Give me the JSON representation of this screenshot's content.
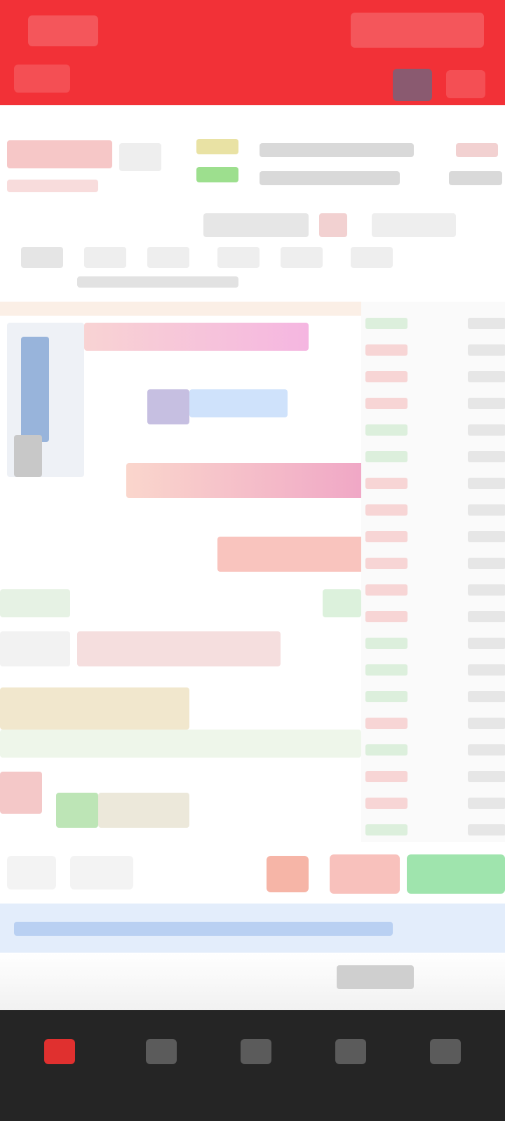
{
  "header": {
    "left_label": "",
    "right_label": "",
    "title": "",
    "subtitle": ""
  },
  "quote": {
    "price": "",
    "change": "",
    "high_label": "",
    "low_label": ""
  },
  "tabs": [],
  "chart": {
    "annotation_1": "",
    "annotation_2": ""
  },
  "order_book": {
    "rows": [
      {
        "price": "",
        "vol": "",
        "dir": "down"
      },
      {
        "price": "",
        "vol": "",
        "dir": "up"
      },
      {
        "price": "",
        "vol": "",
        "dir": "up"
      },
      {
        "price": "",
        "vol": "",
        "dir": "up"
      },
      {
        "price": "",
        "vol": "",
        "dir": "down"
      },
      {
        "price": "",
        "vol": "",
        "dir": "down"
      },
      {
        "price": "",
        "vol": "",
        "dir": "up"
      },
      {
        "price": "",
        "vol": "",
        "dir": "up"
      },
      {
        "price": "",
        "vol": "",
        "dir": "up"
      },
      {
        "price": "",
        "vol": "",
        "dir": "up"
      },
      {
        "price": "",
        "vol": "",
        "dir": "up"
      },
      {
        "price": "",
        "vol": "",
        "dir": "up"
      },
      {
        "price": "",
        "vol": "",
        "dir": "down"
      },
      {
        "price": "",
        "vol": "",
        "dir": "down"
      },
      {
        "price": "",
        "vol": "",
        "dir": "down"
      },
      {
        "price": "",
        "vol": "",
        "dir": "up"
      },
      {
        "price": "",
        "vol": "",
        "dir": "down"
      },
      {
        "price": "",
        "vol": "",
        "dir": "up"
      },
      {
        "price": "",
        "vol": "",
        "dir": "up"
      },
      {
        "price": "",
        "vol": "",
        "dir": "down"
      }
    ]
  },
  "actions": {
    "btn_1": "",
    "btn_2": "",
    "btn_sell": "",
    "btn_buy": ""
  },
  "notice": {
    "text": ""
  },
  "bottom_nav": {
    "items": [
      {
        "label": "",
        "active": true
      },
      {
        "label": "",
        "active": false
      },
      {
        "label": "",
        "active": false
      },
      {
        "label": "",
        "active": false
      },
      {
        "label": "",
        "active": false
      }
    ]
  },
  "colors": {
    "brand_red": "#f23137",
    "up_red": "#e23b3b",
    "down_green": "#27a744",
    "nav_bg": "#252525"
  }
}
